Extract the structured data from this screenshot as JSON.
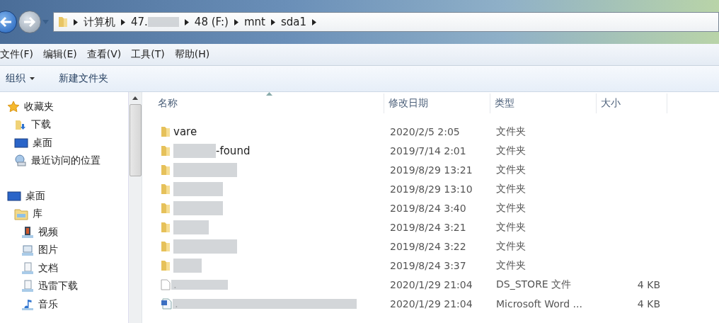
{
  "address_bar": {
    "segments": [
      "计算机",
      "47.",
      "48 (F:)",
      "mnt",
      "sda1"
    ]
  },
  "menu_bar": [
    "文件(F)",
    "编辑(E)",
    "查看(V)",
    "工具(T)",
    "帮助(H)"
  ],
  "toolbar": [
    {
      "label": "组织",
      "dropdown": true
    },
    {
      "label": "新建文件夹",
      "dropdown": false
    }
  ],
  "sidebar": {
    "items": [
      {
        "label": "收藏夹",
        "kind": "star",
        "children": [
          {
            "label": "下载",
            "kind": "download"
          },
          {
            "label": "桌面",
            "kind": "desktop"
          },
          {
            "label": "最近访问的位置",
            "kind": "recent"
          }
        ]
      },
      {
        "label": "桌面",
        "kind": "desktop",
        "children": [
          {
            "label": "库",
            "kind": "library",
            "children": [
              {
                "label": "视频",
                "kind": "video"
              },
              {
                "label": "图片",
                "kind": "image"
              },
              {
                "label": "文档",
                "kind": "doc"
              },
              {
                "label": "迅雷下载",
                "kind": "doc"
              },
              {
                "label": "音乐",
                "kind": "music"
              }
            ]
          }
        ]
      }
    ]
  },
  "table": {
    "columns": [
      "名称",
      "修改日期",
      "类型",
      "大小"
    ],
    "rows": [
      {
        "kind": "folder",
        "name": "vare",
        "date": "2020/2/5 2:05",
        "type": "文件夹"
      },
      {
        "kind": "folder",
        "name": "-found",
        "date": "2019/7/14 2:01",
        "type": "文件夹"
      },
      {
        "kind": "folder",
        "date": "2019/8/29 13:21",
        "type": "文件夹"
      },
      {
        "kind": "folder",
        "date": "2019/8/29 13:10",
        "type": "文件夹"
      },
      {
        "kind": "folder",
        "date": "2019/8/24 3:40",
        "type": "文件夹"
      },
      {
        "kind": "folder",
        "date": "2019/8/24 3:21",
        "type": "文件夹"
      },
      {
        "kind": "folder",
        "date": "2019/8/24 3:22",
        "type": "文件夹"
      },
      {
        "kind": "folder",
        "date": "2019/8/24 3:37",
        "type": "文件夹"
      },
      {
        "kind": "file",
        "name": ".",
        "date": "2020/1/29 21:04",
        "type": "DS_STORE 文件",
        "size": "4 KB"
      },
      {
        "kind": "word",
        "name": ".",
        "date": "2020/1/29 21:04",
        "type": "Microsoft Word ...",
        "size": "4 KB"
      }
    ]
  }
}
